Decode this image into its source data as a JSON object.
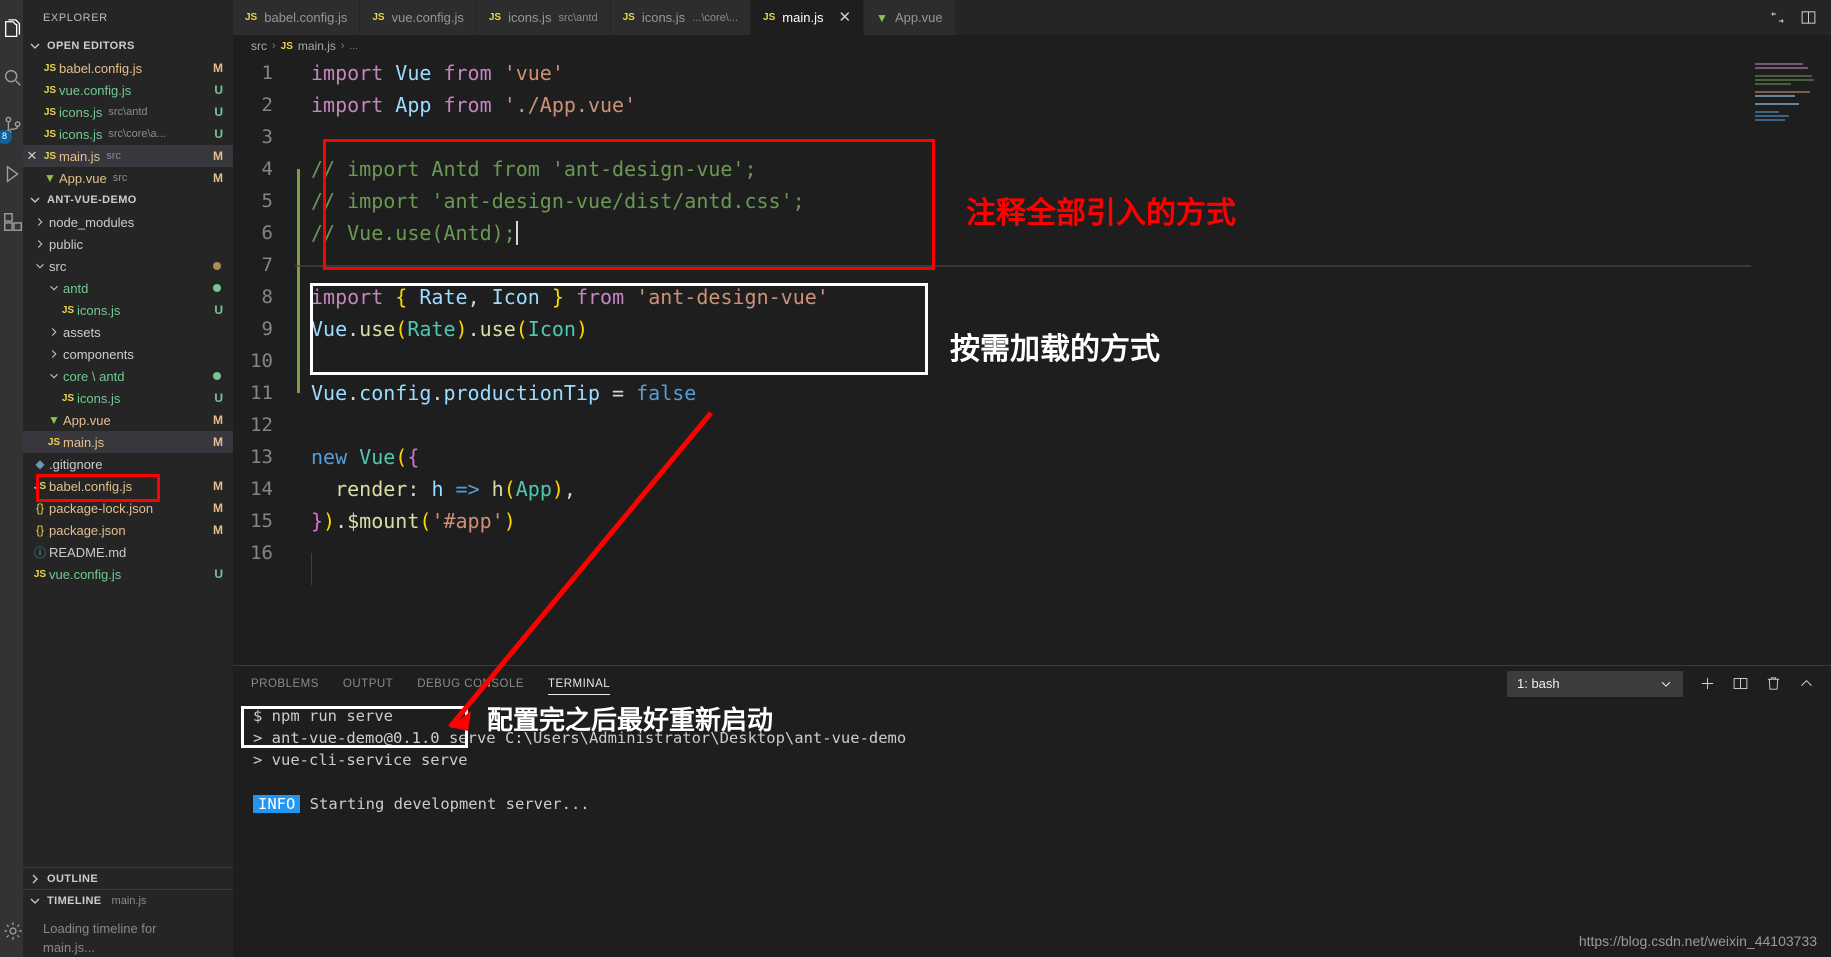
{
  "activity_bar": {
    "items": [
      {
        "name": "explorer",
        "icon": "files-icon",
        "active": true,
        "badge": null
      },
      {
        "name": "search",
        "icon": "search-icon",
        "active": false,
        "badge": null
      },
      {
        "name": "source-control",
        "icon": "source-control-icon",
        "active": false,
        "badge": "8"
      },
      {
        "name": "run-debug",
        "icon": "debug-icon",
        "active": false,
        "badge": null
      },
      {
        "name": "extensions",
        "icon": "extensions-icon",
        "active": false,
        "badge": null
      }
    ],
    "bottom": [
      {
        "name": "manage",
        "icon": "gear-icon"
      }
    ]
  },
  "sidebar": {
    "title": "EXPLORER",
    "open_editors": {
      "header": "OPEN EDITORS",
      "items": [
        {
          "icon": "js-icon",
          "label": "babel.config.js",
          "desc": "",
          "status": "M",
          "status_color": "mod",
          "selected": false,
          "closable": false
        },
        {
          "icon": "js-icon",
          "label": "vue.config.js",
          "desc": "",
          "status": "U",
          "status_color": "untracked",
          "selected": false,
          "closable": false
        },
        {
          "icon": "js-icon",
          "label": "icons.js",
          "desc": "src\\antd",
          "status": "U",
          "status_color": "untracked",
          "selected": false,
          "closable": false
        },
        {
          "icon": "js-icon",
          "label": "icons.js",
          "desc": "src\\core\\a...",
          "status": "U",
          "status_color": "untracked",
          "selected": false,
          "closable": false
        },
        {
          "icon": "js-icon",
          "label": "main.js",
          "desc": "src",
          "status": "M",
          "status_color": "mod",
          "selected": true,
          "closable": true
        },
        {
          "icon": "vue-icon",
          "label": "App.vue",
          "desc": "src",
          "status": "M",
          "status_color": "mod",
          "selected": false,
          "closable": false
        }
      ]
    },
    "project": {
      "header": "ANT-VUE-DEMO",
      "items": [
        {
          "icon": "chevron-right-icon",
          "label": "node_modules",
          "indent": 1,
          "status": "",
          "dot": "",
          "kind": "folder-collapsed"
        },
        {
          "icon": "chevron-right-icon",
          "label": "public",
          "indent": 1,
          "status": "",
          "dot": "",
          "kind": "folder-collapsed"
        },
        {
          "icon": "chevron-down-icon",
          "label": "src",
          "indent": 1,
          "status": "",
          "dot": "#b08a5a",
          "kind": "folder-expanded"
        },
        {
          "icon": "chevron-down-icon",
          "label": "antd",
          "indent": 2,
          "status": "",
          "dot": "#73c991",
          "kind": "folder-expanded",
          "color": "untracked"
        },
        {
          "icon": "js-icon",
          "label": "icons.js",
          "indent": 3,
          "status": "U",
          "dot": "",
          "kind": "file",
          "color": "untracked"
        },
        {
          "icon": "chevron-right-icon",
          "label": "assets",
          "indent": 2,
          "status": "",
          "dot": "",
          "kind": "folder-collapsed"
        },
        {
          "icon": "chevron-right-icon",
          "label": "components",
          "indent": 2,
          "status": "",
          "dot": "",
          "kind": "folder-collapsed"
        },
        {
          "icon": "chevron-down-icon",
          "label": "core \\ antd",
          "indent": 2,
          "status": "",
          "dot": "#73c991",
          "kind": "folder-expanded",
          "color": "untracked"
        },
        {
          "icon": "js-icon",
          "label": "icons.js",
          "indent": 3,
          "status": "U",
          "dot": "",
          "kind": "file",
          "color": "untracked"
        },
        {
          "icon": "vue-icon",
          "label": "App.vue",
          "indent": 2,
          "status": "M",
          "dot": "",
          "kind": "file",
          "color": "mod"
        },
        {
          "icon": "js-icon",
          "label": "main.js",
          "indent": 2,
          "status": "M",
          "dot": "",
          "kind": "file",
          "color": "mod",
          "selected": true,
          "highlighted": true
        },
        {
          "icon": "git-icon",
          "label": ".gitignore",
          "indent": 1,
          "status": "",
          "dot": "",
          "kind": "file"
        },
        {
          "icon": "js-icon",
          "label": "babel.config.js",
          "indent": 1,
          "status": "M",
          "dot": "",
          "kind": "file",
          "color": "mod"
        },
        {
          "icon": "json-icon",
          "label": "package-lock.json",
          "indent": 1,
          "status": "M",
          "dot": "",
          "kind": "file",
          "color": "mod"
        },
        {
          "icon": "json-icon",
          "label": "package.json",
          "indent": 1,
          "status": "M",
          "dot": "",
          "kind": "file",
          "color": "mod"
        },
        {
          "icon": "info-icon",
          "label": "README.md",
          "indent": 1,
          "status": "",
          "dot": "",
          "kind": "file"
        },
        {
          "icon": "js-icon",
          "label": "vue.config.js",
          "indent": 1,
          "status": "U",
          "dot": "",
          "kind": "file",
          "color": "untracked"
        }
      ]
    },
    "outline": {
      "header": "OUTLINE"
    },
    "timeline": {
      "header": "TIMELINE",
      "sub": "main.js",
      "loading_text_line1": "Loading timeline for",
      "loading_text_line2": "main.js..."
    }
  },
  "tabs": [
    {
      "icon": "js-icon",
      "label": "babel.config.js",
      "desc": "",
      "active": false,
      "closable": false
    },
    {
      "icon": "js-icon",
      "label": "vue.config.js",
      "desc": "",
      "active": false,
      "closable": false
    },
    {
      "icon": "js-icon",
      "label": "icons.js",
      "desc": "src\\antd",
      "active": false,
      "closable": false
    },
    {
      "icon": "js-icon",
      "label": "icons.js",
      "desc": "...\\core\\...",
      "active": false,
      "closable": false
    },
    {
      "icon": "js-icon",
      "label": "main.js",
      "desc": "",
      "active": true,
      "closable": true
    },
    {
      "icon": "vue-icon",
      "label": "App.vue",
      "desc": "",
      "active": false,
      "closable": false
    }
  ],
  "tab_actions": [
    {
      "name": "split-editor-icon"
    },
    {
      "name": "open-changes-icon"
    }
  ],
  "breadcrumb": [
    "src",
    "main.js",
    "..."
  ],
  "editor": {
    "lines": [
      {
        "n": "1",
        "tokens": [
          {
            "t": "import",
            "c": "k-import"
          },
          {
            "t": " ",
            "c": "k-plain"
          },
          {
            "t": "Vue",
            "c": "k-ident"
          },
          {
            "t": " ",
            "c": "k-plain"
          },
          {
            "t": "from",
            "c": "k-import"
          },
          {
            "t": " ",
            "c": "k-plain"
          },
          {
            "t": "'vue'",
            "c": "k-str"
          }
        ]
      },
      {
        "n": "2",
        "tokens": [
          {
            "t": "import",
            "c": "k-import"
          },
          {
            "t": " ",
            "c": "k-plain"
          },
          {
            "t": "App",
            "c": "k-ident"
          },
          {
            "t": " ",
            "c": "k-plain"
          },
          {
            "t": "from",
            "c": "k-import"
          },
          {
            "t": " ",
            "c": "k-plain"
          },
          {
            "t": "'./App.vue'",
            "c": "k-str"
          }
        ]
      },
      {
        "n": "3",
        "tokens": []
      },
      {
        "n": "4",
        "tokens": [
          {
            "t": "// import Antd from 'ant-design-vue';",
            "c": "k-cmt"
          }
        ]
      },
      {
        "n": "5",
        "tokens": [
          {
            "t": "// import 'ant-design-vue/dist/antd.css';",
            "c": "k-cmt"
          }
        ]
      },
      {
        "n": "6",
        "tokens": [
          {
            "t": "// Vue.use(Antd);",
            "c": "k-cmt"
          }
        ],
        "cursor": true
      },
      {
        "n": "7",
        "tokens": []
      },
      {
        "n": "8",
        "tokens": [
          {
            "t": "import",
            "c": "k-import"
          },
          {
            "t": " ",
            "c": "k-plain"
          },
          {
            "t": "{",
            "c": "k-brace"
          },
          {
            "t": " ",
            "c": "k-plain"
          },
          {
            "t": "Rate",
            "c": "k-ident"
          },
          {
            "t": ", ",
            "c": "k-plain"
          },
          {
            "t": "Icon",
            "c": "k-ident"
          },
          {
            "t": " ",
            "c": "k-plain"
          },
          {
            "t": "}",
            "c": "k-brace"
          },
          {
            "t": " ",
            "c": "k-plain"
          },
          {
            "t": "from",
            "c": "k-import"
          },
          {
            "t": " ",
            "c": "k-plain"
          },
          {
            "t": "'ant-design-vue'",
            "c": "k-str"
          }
        ]
      },
      {
        "n": "9",
        "tokens": [
          {
            "t": "Vue",
            "c": "k-ident"
          },
          {
            "t": ".",
            "c": "k-plain"
          },
          {
            "t": "use",
            "c": "k-fn"
          },
          {
            "t": "(",
            "c": "k-brace"
          },
          {
            "t": "Rate",
            "c": "k-cls"
          },
          {
            "t": ")",
            "c": "k-brace"
          },
          {
            "t": ".",
            "c": "k-plain"
          },
          {
            "t": "use",
            "c": "k-fn"
          },
          {
            "t": "(",
            "c": "k-brace"
          },
          {
            "t": "Icon",
            "c": "k-cls"
          },
          {
            "t": ")",
            "c": "k-brace"
          }
        ]
      },
      {
        "n": "10",
        "tokens": []
      },
      {
        "n": "11",
        "tokens": [
          {
            "t": "Vue",
            "c": "k-ident"
          },
          {
            "t": ".",
            "c": "k-plain"
          },
          {
            "t": "config",
            "c": "k-ident"
          },
          {
            "t": ".",
            "c": "k-plain"
          },
          {
            "t": "productionTip",
            "c": "k-ident"
          },
          {
            "t": " = ",
            "c": "k-plain"
          },
          {
            "t": "false",
            "c": "k-kw"
          }
        ]
      },
      {
        "n": "12",
        "tokens": []
      },
      {
        "n": "13",
        "tokens": [
          {
            "t": "new",
            "c": "k-kw"
          },
          {
            "t": " ",
            "c": "k-plain"
          },
          {
            "t": "Vue",
            "c": "k-cls"
          },
          {
            "t": "(",
            "c": "k-brace"
          },
          {
            "t": "{",
            "c": "k-brace2"
          }
        ]
      },
      {
        "n": "14",
        "tokens": [
          {
            "t": "  ",
            "c": "k-plain"
          },
          {
            "t": "render",
            "c": "k-fn"
          },
          {
            "t": ": ",
            "c": "k-plain"
          },
          {
            "t": "h",
            "c": "k-ident"
          },
          {
            "t": " => ",
            "c": "k-kw"
          },
          {
            "t": "h",
            "c": "k-fn"
          },
          {
            "t": "(",
            "c": "k-brace"
          },
          {
            "t": "App",
            "c": "k-cls"
          },
          {
            "t": ")",
            "c": "k-brace"
          },
          {
            "t": ",",
            "c": "k-plain"
          }
        ]
      },
      {
        "n": "15",
        "tokens": [
          {
            "t": "}",
            "c": "k-brace2"
          },
          {
            "t": ")",
            "c": "k-brace"
          },
          {
            "t": ".",
            "c": "k-plain"
          },
          {
            "t": "$mount",
            "c": "k-fn"
          },
          {
            "t": "(",
            "c": "k-brace"
          },
          {
            "t": "'#app'",
            "c": "k-str"
          },
          {
            "t": ")",
            "c": "k-brace"
          }
        ]
      },
      {
        "n": "16",
        "tokens": []
      }
    ]
  },
  "panel": {
    "tabs": [
      {
        "label": "PROBLEMS",
        "active": false
      },
      {
        "label": "OUTPUT",
        "active": false
      },
      {
        "label": "DEBUG CONSOLE",
        "active": false
      },
      {
        "label": "TERMINAL",
        "active": true
      }
    ],
    "terminal_select": {
      "value": "1: bash",
      "chevron": "chevron-down-icon"
    },
    "actions": [
      {
        "name": "new-terminal-icon"
      },
      {
        "name": "split-terminal-icon"
      },
      {
        "name": "kill-terminal-icon"
      },
      {
        "name": "close-panel-icon"
      }
    ],
    "terminal_lines": [
      {
        "text": "$ npm run serve",
        "kind": "command"
      },
      {
        "text": "> ant-vue-demo@0.1.0 serve C:\\Users\\Administrator\\Desktop\\ant-vue-demo",
        "kind": "plain"
      },
      {
        "text": "> vue-cli-service serve",
        "kind": "plain"
      },
      {
        "text": "",
        "kind": "plain"
      },
      {
        "text": "Starting development server...",
        "kind": "info",
        "badge": "INFO"
      }
    ]
  },
  "annotations": {
    "comment_note": "注释全部引入的方式",
    "ondemand_note": "按需加载的方式",
    "restart_note": "配置完之后最好重新启动"
  },
  "watermark": "https://blog.csdn.net/weixin_44103733",
  "colors": {
    "accent_red": "#ff0000",
    "accent_white": "#ffffff",
    "editor_bg": "#1e1e1e",
    "sidebar_bg": "#252526",
    "activitybar_bg": "#333333",
    "badge_blue": "#0e639c",
    "info_blue": "#2196f3",
    "modified": "#e2c08d",
    "untracked": "#73c991"
  }
}
